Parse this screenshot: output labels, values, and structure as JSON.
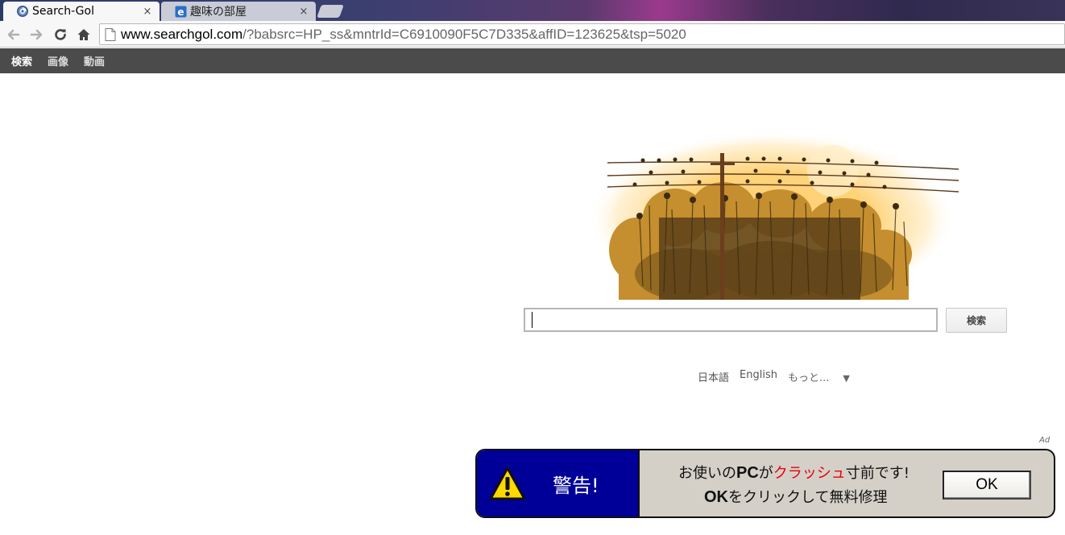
{
  "browser": {
    "tabs": [
      {
        "title": "Search-Gol",
        "close": "×",
        "icon": "searchgol-favicon",
        "active": true
      },
      {
        "title": "趣味の部屋",
        "close": "×",
        "icon": "ie-favicon",
        "active": false
      }
    ],
    "url": {
      "host": "www.searchgol.com",
      "path": "/?babsrc=HP_ss&mntrId=C6910090F5C7D335&affID=123625&tsp=5020"
    }
  },
  "nav": {
    "items": [
      "検索",
      "画像",
      "動画"
    ],
    "current": 0
  },
  "search": {
    "value": "",
    "button_label": "検索"
  },
  "languages": {
    "items": [
      "日本語",
      "English"
    ],
    "more": "もっと...",
    "more_arrow": "▼"
  },
  "ad": {
    "label": "Ad",
    "warning": "警告!",
    "line1": {
      "pre": "お使いの",
      "pc": "PC",
      "ga": "が",
      "crash": "クラッシュ",
      "post": "寸前です!"
    },
    "line2": {
      "ok": "OK",
      "rest": "をクリックして無料修理"
    },
    "ok_button": "OK",
    "colors": {
      "left_bg": "#000099",
      "right_bg": "#d4d0c8",
      "crash": "#e8000b"
    }
  }
}
